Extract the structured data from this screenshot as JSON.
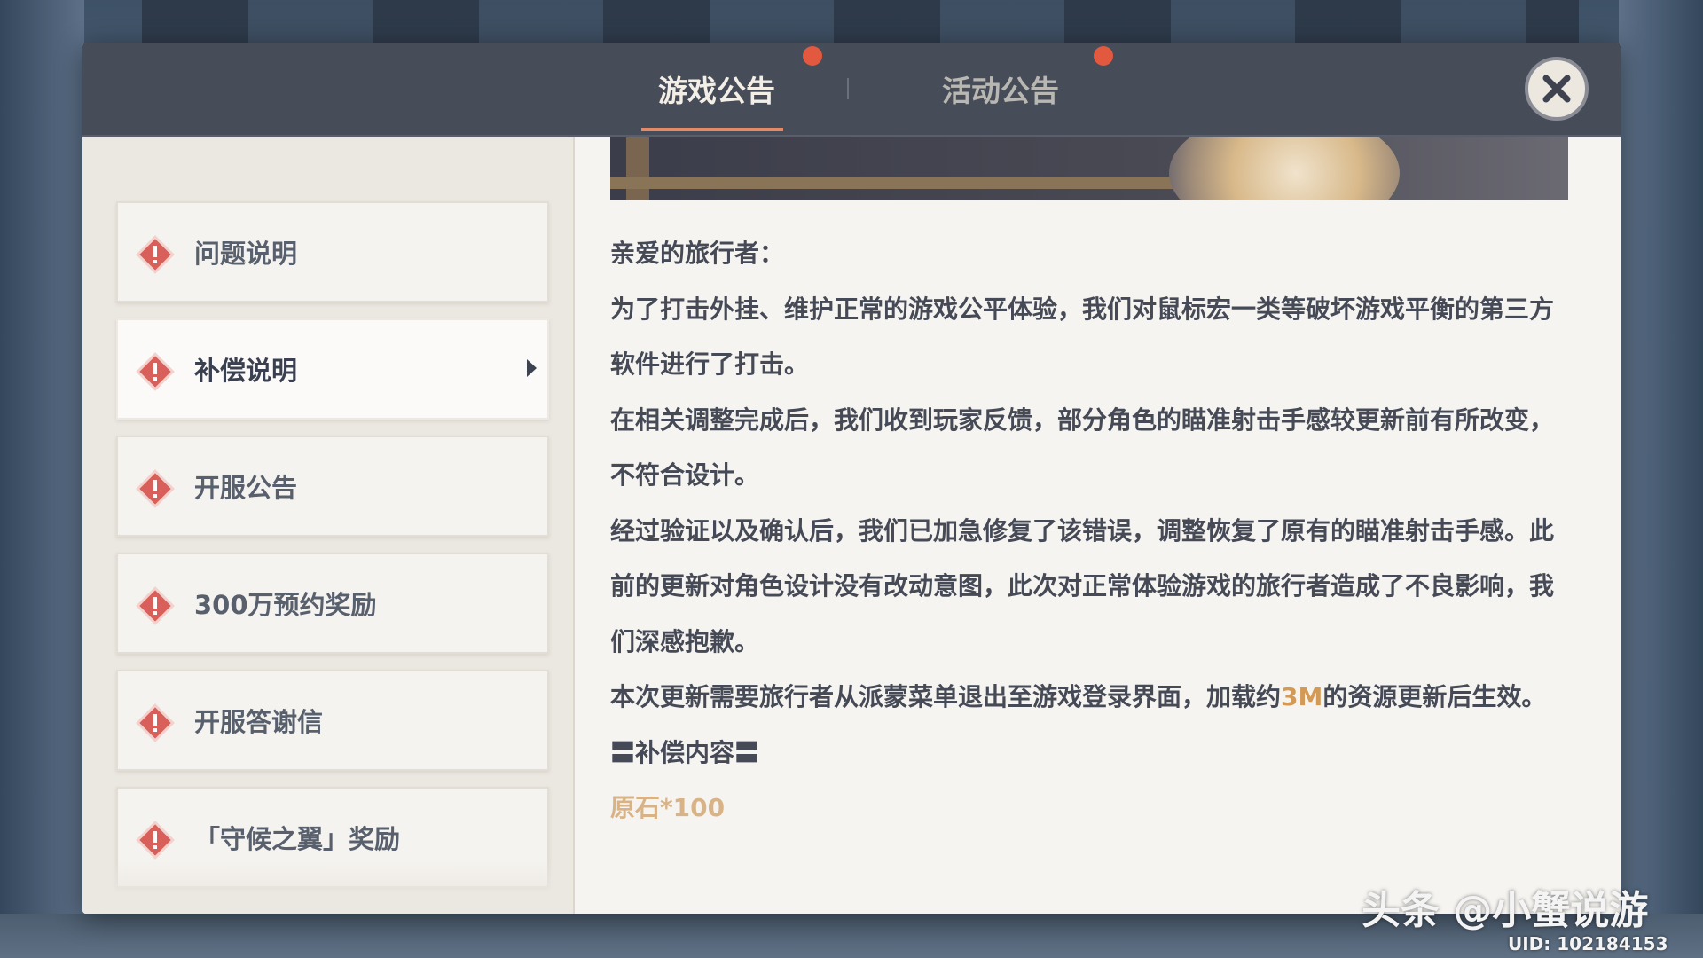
{
  "tabs": {
    "game": "游戏公告",
    "event": "活动公告"
  },
  "sidebar": {
    "items": [
      {
        "label": "问题说明"
      },
      {
        "label": "补偿说明"
      },
      {
        "label": "开服公告"
      },
      {
        "label": "300万预约奖励"
      },
      {
        "label": "开服答谢信"
      },
      {
        "label": "「守候之翼」奖励"
      }
    ]
  },
  "article": {
    "greeting": "亲爱的旅行者：",
    "p1": "为了打击外挂、维护正常的游戏公平体验，我们对鼠标宏一类等破坏游戏平衡的第三方软件进行了打击。",
    "p2": "在相关调整完成后，我们收到玩家反馈，部分角色的瞄准射击手感较更新前有所改变，不符合设计。",
    "p3": "经过验证以及确认后，我们已加急修复了该错误，调整恢复了原有的瞄准射击手感。此前的更新对角色设计没有改动意图，此次对正常体验游戏的旅行者造成了不良影响，我们深感抱歉。",
    "p4_before": "本次更新需要旅行者从派蒙菜单退出至游戏登录界面，加载约",
    "p4_highlight": "3M",
    "p4_after": "的资源更新后生效。",
    "section_title": "〓补偿内容〓",
    "reward": "原石*100"
  },
  "watermark": {
    "text": "头条 @小蟹说游",
    "uid": "UID: 102184153"
  },
  "colors": {
    "tab_dot": "#e2593f",
    "tab_underline": "#e58a64",
    "warn_icon": "#d9605a",
    "highlight": "#d39a57"
  },
  "icons": {
    "close": "close-icon",
    "item": "warning-diamond-icon",
    "active_arrow": "caret-right-icon"
  }
}
